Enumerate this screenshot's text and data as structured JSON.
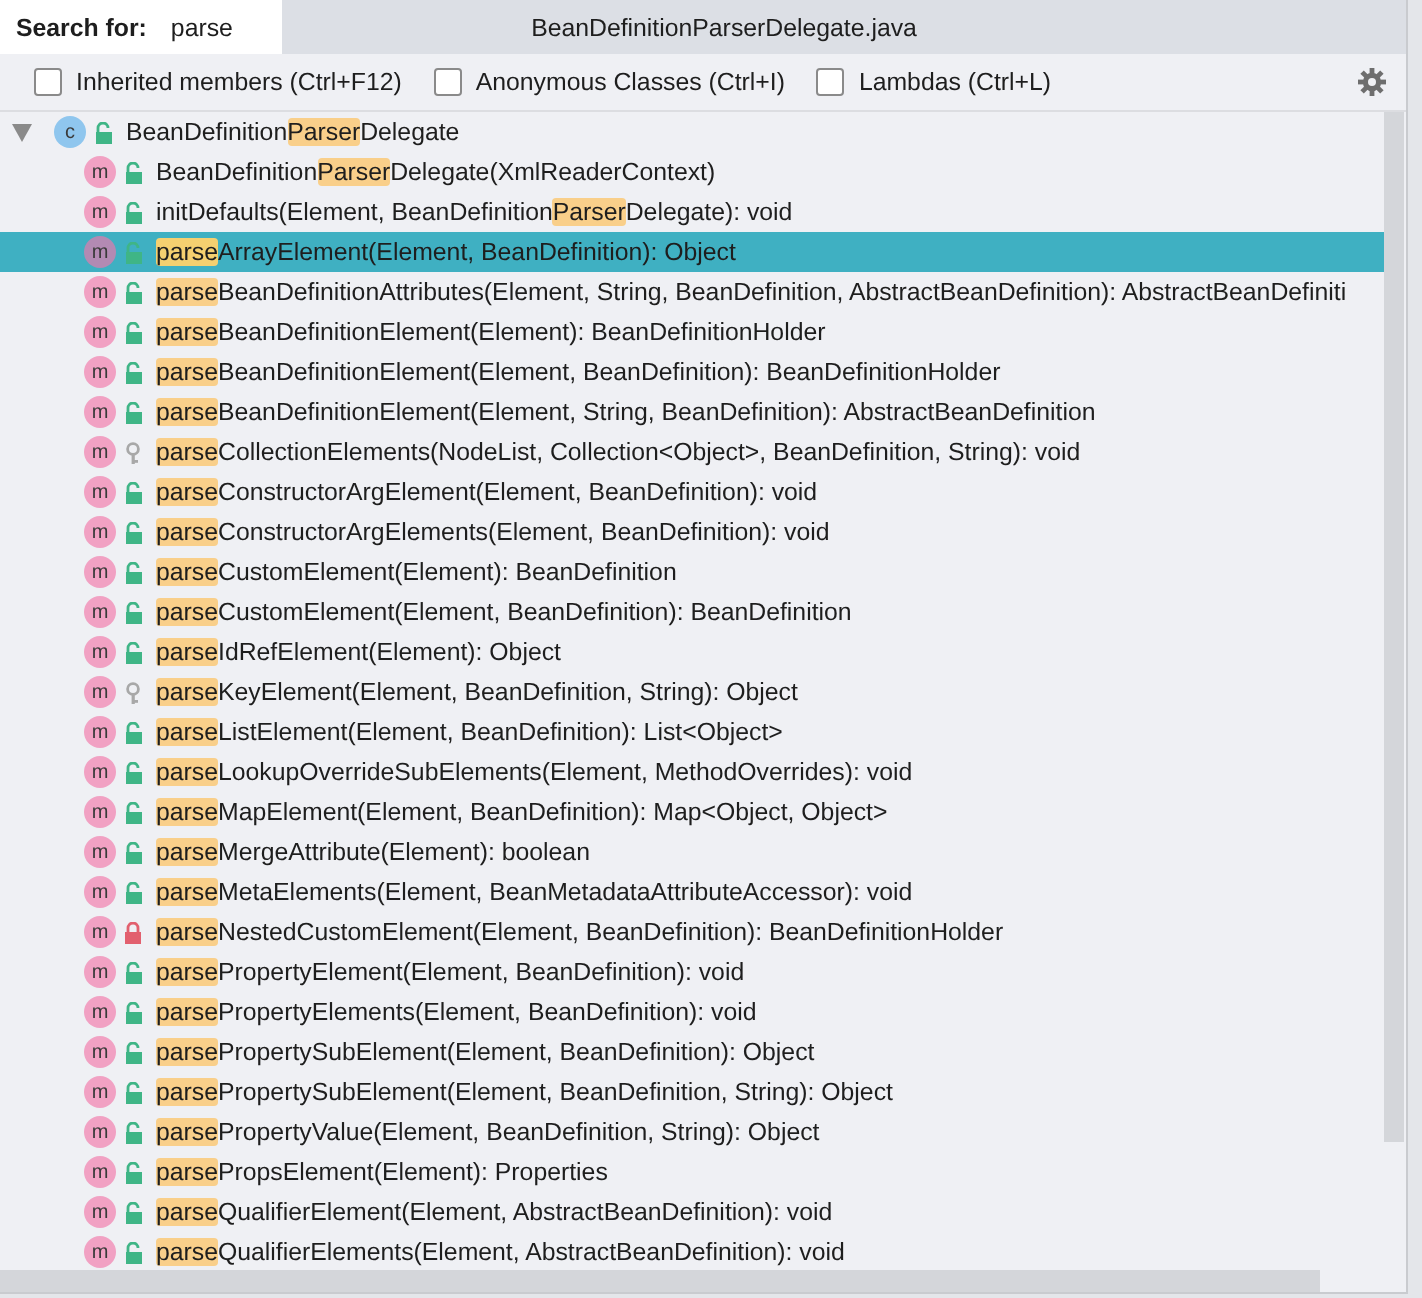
{
  "search": {
    "label": "Search for:",
    "value": "parse"
  },
  "window": {
    "title": "BeanDefinitionParserDelegate.java"
  },
  "filters": [
    {
      "label": "Inherited members (Ctrl+F12)",
      "checked": false
    },
    {
      "label": "Anonymous Classes (Ctrl+I)",
      "checked": false
    },
    {
      "label": "Lambdas (Ctrl+L)",
      "checked": false
    }
  ],
  "tree": {
    "badge": "c",
    "kind": "public",
    "label": "BeanDefinition**Parser**Delegate",
    "expanded": true,
    "children": [
      {
        "badge": "m",
        "kind": "public",
        "selected": false,
        "label": "BeanDefinition**Parser**Delegate(XmlReaderContext)"
      },
      {
        "badge": "m",
        "kind": "public",
        "selected": false,
        "label": "initDefaults(Element, BeanDefinition**Parser**Delegate): void"
      },
      {
        "badge": "m",
        "kind": "public",
        "selected": true,
        "label": "**parse**ArrayElement(Element, BeanDefinition): Object"
      },
      {
        "badge": "m",
        "kind": "public",
        "selected": false,
        "label": "**parse**BeanDefinitionAttributes(Element, String, BeanDefinition, AbstractBeanDefinition): AbstractBeanDefiniti"
      },
      {
        "badge": "m",
        "kind": "public",
        "selected": false,
        "label": "**parse**BeanDefinitionElement(Element): BeanDefinitionHolder"
      },
      {
        "badge": "m",
        "kind": "public",
        "selected": false,
        "label": "**parse**BeanDefinitionElement(Element, BeanDefinition): BeanDefinitionHolder"
      },
      {
        "badge": "m",
        "kind": "public",
        "selected": false,
        "label": "**parse**BeanDefinitionElement(Element, String, BeanDefinition): AbstractBeanDefinition"
      },
      {
        "badge": "m",
        "kind": "package",
        "selected": false,
        "label": "**parse**CollectionElements(NodeList, Collection<Object>, BeanDefinition, String): void"
      },
      {
        "badge": "m",
        "kind": "public",
        "selected": false,
        "label": "**parse**ConstructorArgElement(Element, BeanDefinition): void"
      },
      {
        "badge": "m",
        "kind": "public",
        "selected": false,
        "label": "**parse**ConstructorArgElements(Element, BeanDefinition): void"
      },
      {
        "badge": "m",
        "kind": "public",
        "selected": false,
        "label": "**parse**CustomElement(Element): BeanDefinition"
      },
      {
        "badge": "m",
        "kind": "public",
        "selected": false,
        "label": "**parse**CustomElement(Element, BeanDefinition): BeanDefinition"
      },
      {
        "badge": "m",
        "kind": "public",
        "selected": false,
        "label": "**parse**IdRefElement(Element): Object"
      },
      {
        "badge": "m",
        "kind": "package",
        "selected": false,
        "label": "**parse**KeyElement(Element, BeanDefinition, String): Object"
      },
      {
        "badge": "m",
        "kind": "public",
        "selected": false,
        "label": "**parse**ListElement(Element, BeanDefinition): List<Object>"
      },
      {
        "badge": "m",
        "kind": "public",
        "selected": false,
        "label": "**parse**LookupOverrideSubElements(Element, MethodOverrides): void"
      },
      {
        "badge": "m",
        "kind": "public",
        "selected": false,
        "label": "**parse**MapElement(Element, BeanDefinition): Map<Object, Object>"
      },
      {
        "badge": "m",
        "kind": "public",
        "selected": false,
        "label": "**parse**MergeAttribute(Element): boolean"
      },
      {
        "badge": "m",
        "kind": "public",
        "selected": false,
        "label": "**parse**MetaElements(Element, BeanMetadataAttributeAccessor): void"
      },
      {
        "badge": "m",
        "kind": "private",
        "selected": false,
        "label": "**parse**NestedCustomElement(Element, BeanDefinition): BeanDefinitionHolder"
      },
      {
        "badge": "m",
        "kind": "public",
        "selected": false,
        "label": "**parse**PropertyElement(Element, BeanDefinition): void"
      },
      {
        "badge": "m",
        "kind": "public",
        "selected": false,
        "label": "**parse**PropertyElements(Element, BeanDefinition): void"
      },
      {
        "badge": "m",
        "kind": "public",
        "selected": false,
        "label": "**parse**PropertySubElement(Element, BeanDefinition): Object"
      },
      {
        "badge": "m",
        "kind": "public",
        "selected": false,
        "label": "**parse**PropertySubElement(Element, BeanDefinition, String): Object"
      },
      {
        "badge": "m",
        "kind": "public",
        "selected": false,
        "label": "**parse**PropertyValue(Element, BeanDefinition, String): Object"
      },
      {
        "badge": "m",
        "kind": "public",
        "selected": false,
        "label": "**parse**PropsElement(Element): Properties"
      },
      {
        "badge": "m",
        "kind": "public",
        "selected": false,
        "label": "**parse**QualifierElement(Element, AbstractBeanDefinition): void"
      },
      {
        "badge": "m",
        "kind": "public",
        "selected": false,
        "label": "**parse**QualifierElements(Element, AbstractBeanDefinition): void"
      }
    ]
  }
}
